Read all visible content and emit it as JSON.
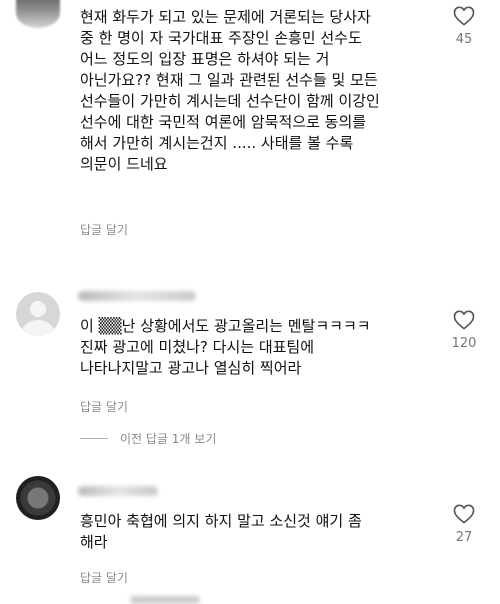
{
  "comments": [
    {
      "text": "현재 화두가 되고 있는 문제에 거론되는 당사자\n중 한 명이 자 국가대표 주장인 손흥민 선수도\n어느 정도의 입장 표명은 하셔야 되는 거\n아닌가요?? 현재 그 일과 관련된 선수들 및 모든\n선수들이 가만히 계시는데 선수단이 함께 이강인\n선수에 대한 국민적 여론에 암묵적으로 동의를\n해서 가만히 계시는건지 ..... 사태를 볼 수록\n의문이 드네요",
      "reply_label": "답글 달기",
      "likes": "45"
    },
    {
      "text": "이 ▒▒난 상황에서도 광고올리는 멘탈ㅋㅋㅋㅋ\n진짜 광고에 미쳤나? 다시는 대표팀에\n나타나지말고 광고나 열심히 찍어라",
      "reply_label": "답글 달기",
      "likes": "120",
      "view_previous": "이전 답글 1개 보기"
    },
    {
      "text": "흥민아 축협에 의지 하지 말고 소신것  얘기 좀\n해라",
      "reply_label": "답글 달기",
      "likes": "27"
    }
  ],
  "icons": {
    "like": "heart-outline-icon"
  },
  "colors": {
    "text": "#111111",
    "secondary": "#8a8a8a",
    "count": "#777777"
  }
}
